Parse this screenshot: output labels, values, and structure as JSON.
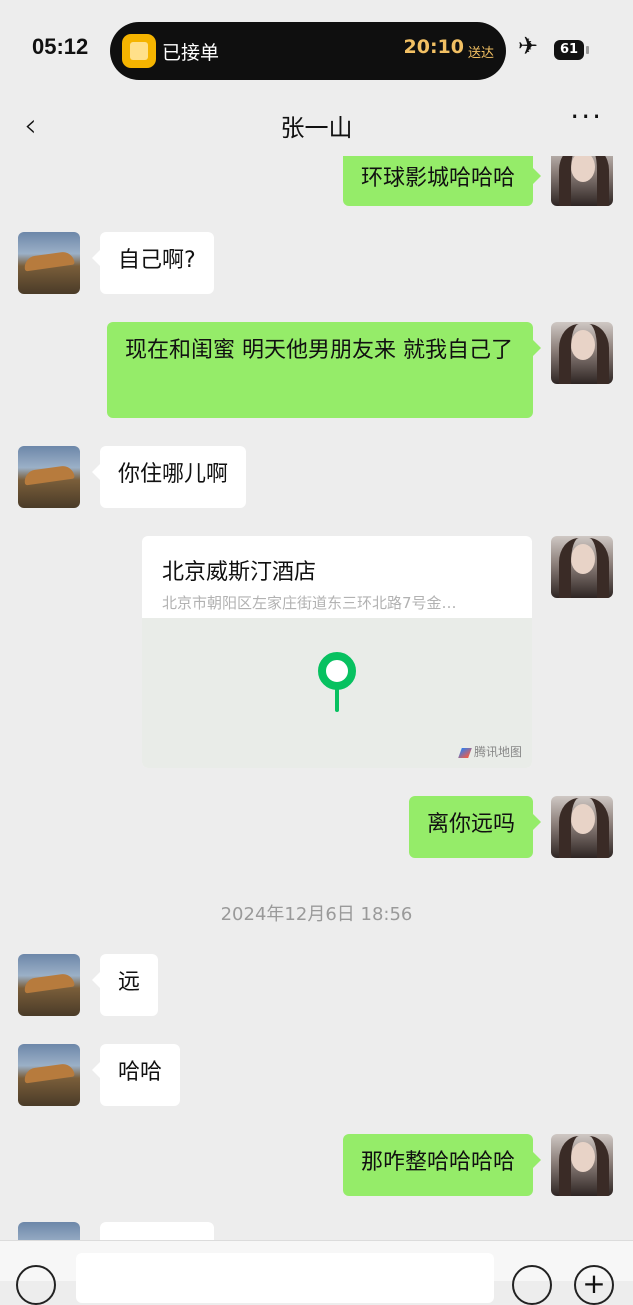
{
  "status_bar": {
    "time": "05:12",
    "order_status": "已接单",
    "eta_time": "20:10",
    "eta_suffix": "送达",
    "airplane_icon": "airplane-icon",
    "battery": "61"
  },
  "nav": {
    "back_icon": "chevron-left-icon",
    "title": "张一山",
    "more_icon": "more-dots-icon"
  },
  "messages": [
    {
      "side": "right",
      "text": "环球影城哈哈哈"
    },
    {
      "side": "left",
      "text": "自己啊?"
    },
    {
      "side": "right",
      "text": "现在和闺蜜 明天他男朋友来 就我自己了"
    },
    {
      "side": "left",
      "text": "你住哪儿啊"
    },
    {
      "side": "right",
      "type": "location",
      "name": "北京威斯汀酒店",
      "address": "北京市朝阳区左家庄街道东三环北路7号金…",
      "map_brand": "腾讯地图"
    },
    {
      "side": "right",
      "text": "离你远吗"
    },
    {
      "type": "timestamp",
      "text": "2024年12月6日 18:56"
    },
    {
      "side": "left",
      "text": "远"
    },
    {
      "side": "left",
      "text": "哈哈"
    },
    {
      "side": "right",
      "text": "那咋整哈哈哈哈"
    }
  ],
  "input_bar": {
    "voice_icon": "voice-icon",
    "emoji_icon": "emoji-icon",
    "plus_icon": "plus-icon",
    "plus_glyph": "+"
  }
}
